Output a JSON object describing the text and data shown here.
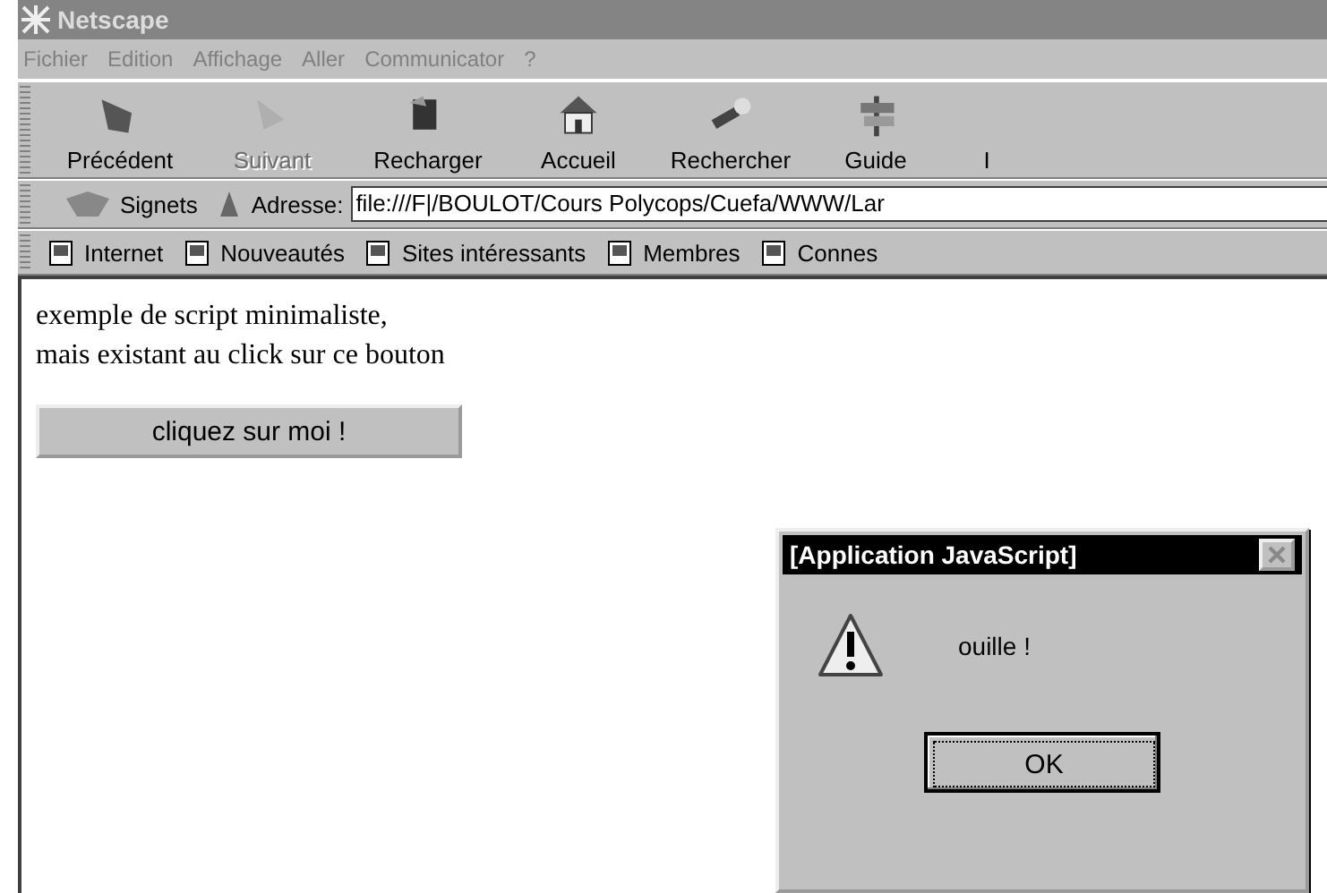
{
  "window": {
    "title": "Netscape"
  },
  "menu": [
    "Fichier",
    "Edition",
    "Affichage",
    "Aller",
    "Communicator",
    "?"
  ],
  "toolbar": [
    {
      "label": "Précédent",
      "disabled": false
    },
    {
      "label": "Suivant",
      "disabled": true
    },
    {
      "label": "Recharger",
      "disabled": false
    },
    {
      "label": "Accueil",
      "disabled": false
    },
    {
      "label": "Rechercher",
      "disabled": false
    },
    {
      "label": "Guide",
      "disabled": false
    },
    {
      "label": "I",
      "disabled": false
    }
  ],
  "location_bar": {
    "bookmarks": "Signets",
    "address_label": "Adresse:",
    "address": "file:///F|/BOULOT/Cours Polycops/Cuefa/WWW/Lar"
  },
  "personal_bar": [
    "Internet",
    "Nouveautés",
    "Sites intéressants",
    "Membres",
    "Connes"
  ],
  "content": {
    "lines": [
      "exemple de script minimaliste,",
      "mais existant au click sur ce bouton"
    ],
    "button": "cliquez sur moi !"
  },
  "dialog": {
    "title": "[Application JavaScript]",
    "message": "ouille !",
    "button": "OK"
  }
}
